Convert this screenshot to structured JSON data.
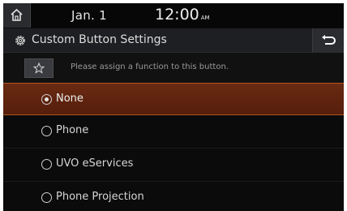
{
  "status": {
    "date": "Jan.  1",
    "time": "12:00",
    "ampm": "AM"
  },
  "header": {
    "title": "Custom Button Settings"
  },
  "assign": {
    "hint": "Please assign a function to this button."
  },
  "options": [
    {
      "label": "None",
      "selected": true
    },
    {
      "label": "Phone",
      "selected": false
    },
    {
      "label": "UVO eServices",
      "selected": false
    },
    {
      "label": "Phone Projection",
      "selected": false
    }
  ],
  "colors": {
    "selected_bg": "#5e2410",
    "selected_border": "#b5541e",
    "background": "#0b0b0c"
  }
}
